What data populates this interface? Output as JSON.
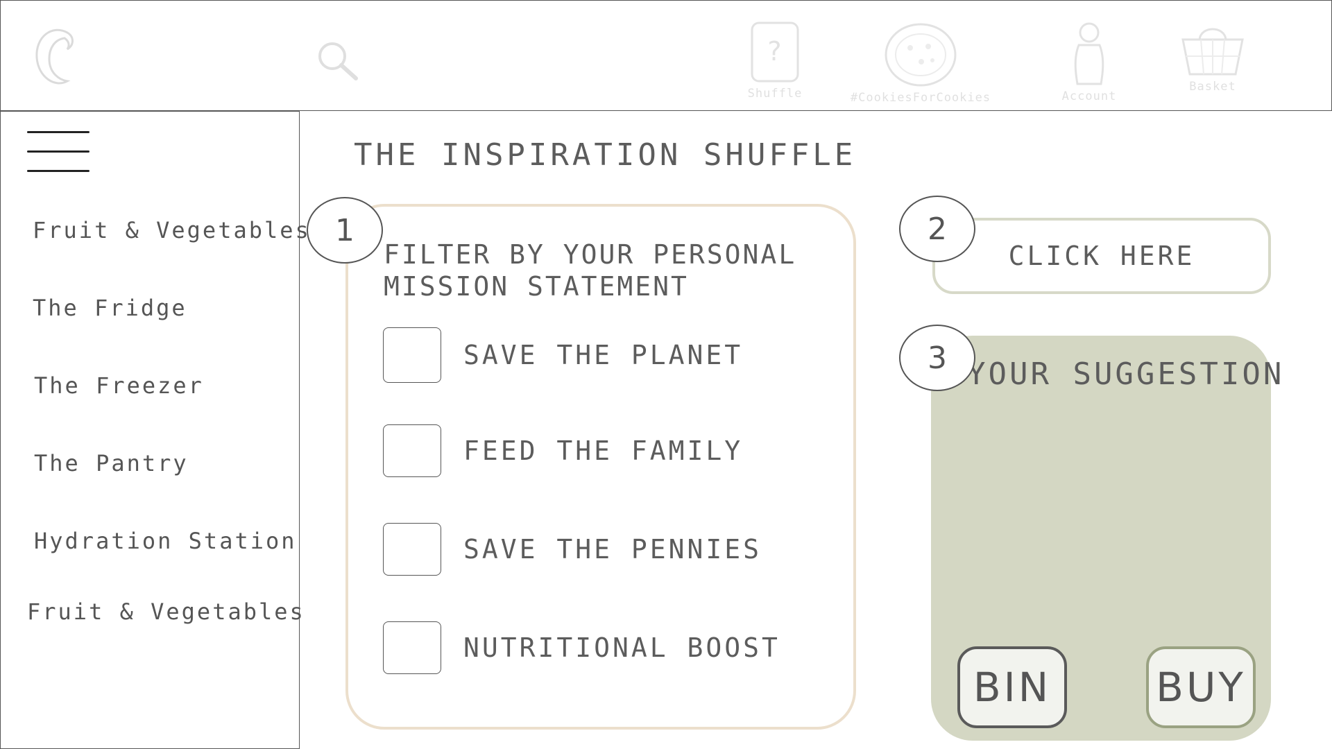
{
  "header": {
    "nav": [
      {
        "label": "Shuffle",
        "icon": "question-card-icon"
      },
      {
        "label": "#CookiesForCookies",
        "icon": "cookie-icon"
      },
      {
        "label": "Account",
        "icon": "person-icon"
      },
      {
        "label": "Basket",
        "icon": "basket-icon"
      }
    ]
  },
  "sidebar": {
    "items": [
      {
        "label": "Fruit & Vegetables"
      },
      {
        "label": "The Fridge"
      },
      {
        "label": "The Freezer"
      },
      {
        "label": "The Pantry"
      },
      {
        "label": "Hydration Station"
      },
      {
        "label": "Fruit & Vegetables"
      }
    ]
  },
  "main": {
    "title": "THE INSPIRATION SHUFFLE",
    "steps": [
      "1",
      "2",
      "3"
    ],
    "filter": {
      "heading_line1": "FILTER BY YOUR PERSONAL",
      "heading_line2": "MISSION STATEMENT",
      "options": [
        {
          "label": "SAVE THE PLANET"
        },
        {
          "label": "FEED THE FAMILY"
        },
        {
          "label": "SAVE THE PENNIES"
        },
        {
          "label": "NUTRITIONAL BOOST"
        }
      ]
    },
    "click_here_label": "CLICK HERE",
    "suggestion": {
      "title": "YOUR SUGGESTION",
      "bin_label": "BIN",
      "buy_label": "BUY"
    }
  },
  "colors": {
    "filter_border": "#ecdfcc",
    "suggestion_bg": "#d4d7c3",
    "click_here_border": "#d7d9c8",
    "buy_border": "#9aa282"
  }
}
